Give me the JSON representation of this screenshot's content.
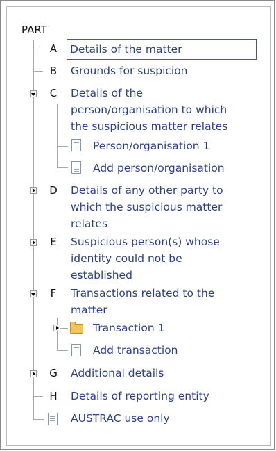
{
  "tree": {
    "root_label": "PART",
    "parts": {
      "a": {
        "letter": "A",
        "label": "Details of the matter",
        "selected": true
      },
      "b": {
        "letter": "B",
        "label": "Grounds for suspicion"
      },
      "c": {
        "letter": "C",
        "label_lines": [
          "Details of the",
          "person/organisation to which",
          "the suspicious matter relates"
        ],
        "state": "expanded",
        "children": {
          "person1": "Person/organisation 1",
          "add": "Add person/organisation"
        }
      },
      "d": {
        "letter": "D",
        "label_lines": [
          "Details of any other party to",
          "which the suspicious matter",
          "relates"
        ],
        "state": "collapsed"
      },
      "e": {
        "letter": "E",
        "label_lines": [
          "Suspicious person(s) whose",
          "identity could not be",
          "established"
        ],
        "state": "collapsed"
      },
      "f": {
        "letter": "F",
        "label_lines": [
          "Transactions related to the",
          "matter"
        ],
        "state": "expanded",
        "children": {
          "transaction1": "Transaction 1",
          "add": "Add transaction"
        }
      },
      "g": {
        "letter": "G",
        "label": "Additional details",
        "state": "collapsed"
      },
      "h": {
        "letter": "H",
        "label": "Details of reporting entity"
      },
      "austrac": {
        "label": "AUSTRAC use only"
      }
    }
  },
  "colors": {
    "link": "#2b3f95",
    "tree_line": "#a9a9a9",
    "folder": "#f4c35e"
  },
  "icons": {
    "expanded": "triangle-down-icon",
    "collapsed": "triangle-right-icon",
    "document": "document-icon",
    "folder": "folder-icon"
  }
}
